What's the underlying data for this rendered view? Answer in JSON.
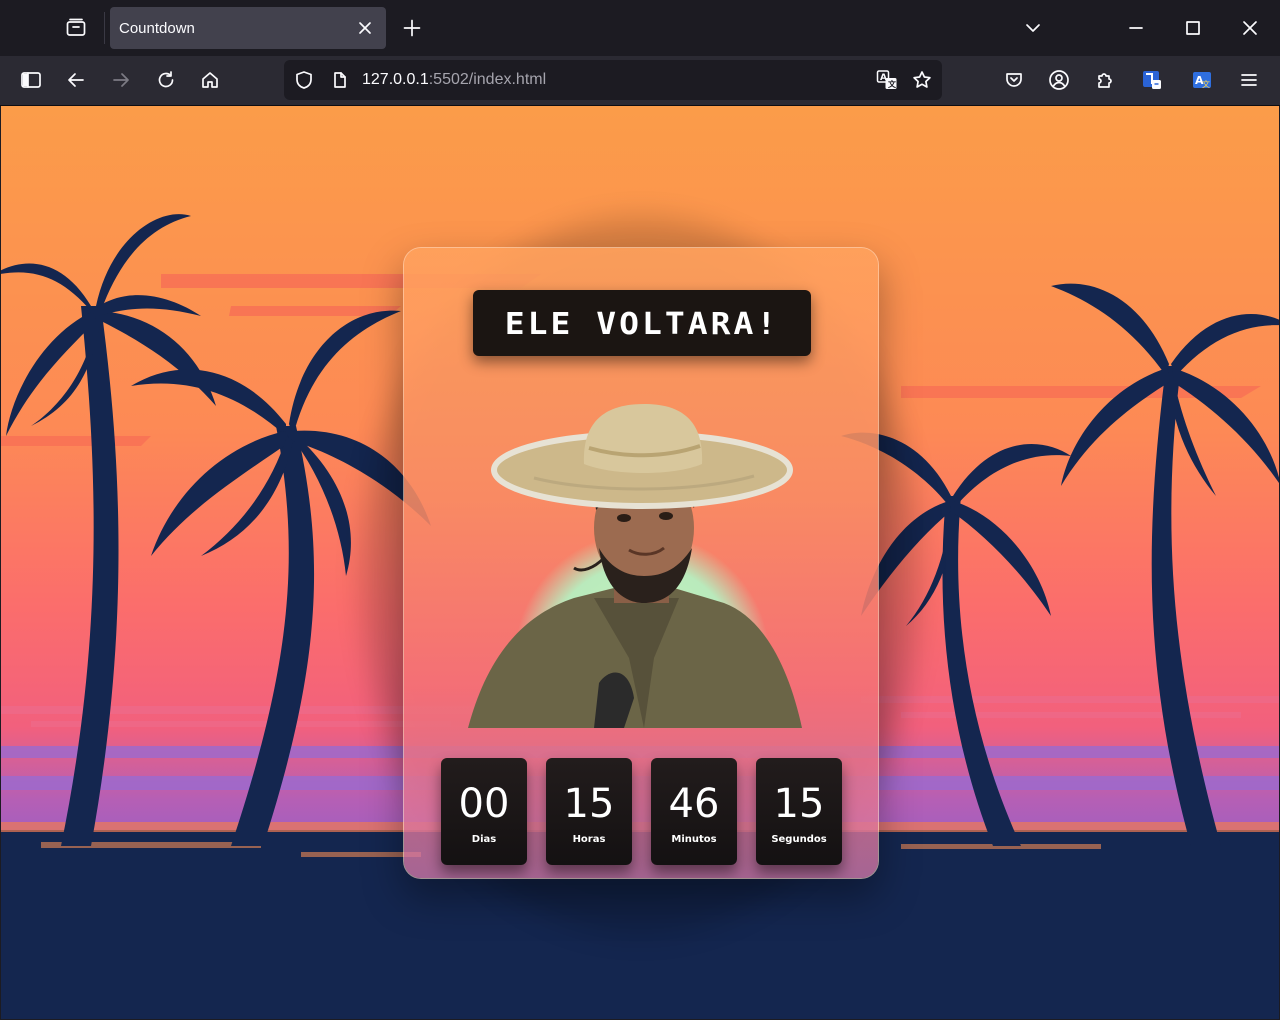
{
  "browser": {
    "tab_title": "Countdown",
    "url_host": "127.0.0.1",
    "url_rest": ":5502/index.html"
  },
  "page": {
    "heading": "ELE VOLTARA!",
    "countdown": [
      {
        "value": "00",
        "label": "Dias"
      },
      {
        "value": "15",
        "label": "Horas"
      },
      {
        "value": "46",
        "label": "Minutos"
      },
      {
        "value": "15",
        "label": "Segundos"
      }
    ]
  },
  "colors": {
    "sky_top": "#fb9a4c",
    "sky_mid": "#fd7d5d",
    "sky_pink": "#f76a7c",
    "sea_purple": "#9a5fc4",
    "silhouette": "#14264f",
    "counter_bg": "#1a1516"
  }
}
